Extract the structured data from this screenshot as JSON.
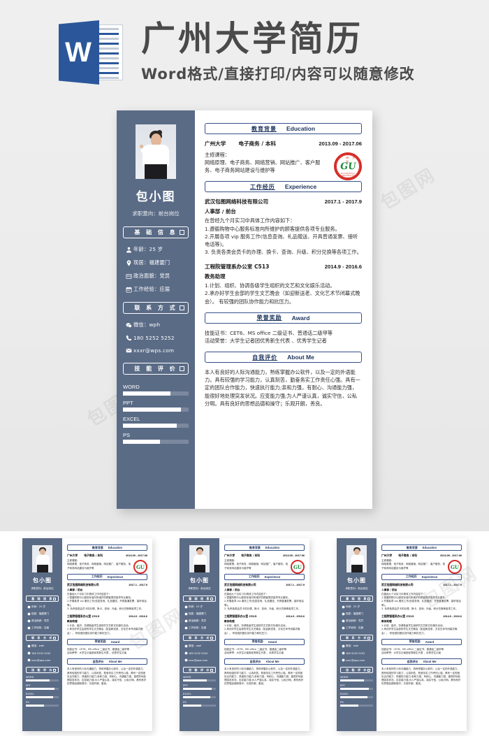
{
  "banner": {
    "title": "广州大学简历",
    "subtitle": "Word格式/直接打印/内容可以随意修改",
    "word_icon_letter": "W",
    "icon_name": "word-document-icon"
  },
  "colors": {
    "sidebar": "#5a6b86",
    "accent_blue": "#35508a",
    "heading_blue": "#20365f",
    "word_blue": "#2b579a",
    "seal_red": "#d62b26",
    "seal_green": "#1f8a3b",
    "page_bg": "#ececec"
  },
  "resume": {
    "sidebar": {
      "photo_alt": "candidate-portrait",
      "name": "包小图",
      "job_intention": "求职意向：前台岗位",
      "sections": [
        {
          "cn": "基 础 信 息",
          "key": "basic-info"
        },
        {
          "cn": "联 系 方 式",
          "key": "contact"
        },
        {
          "cn": "技 能 评 价",
          "key": "skills"
        }
      ],
      "basic_info": [
        {
          "icon": "user-icon",
          "text": "年龄：25 岁"
        },
        {
          "icon": "location-pin-icon",
          "text": "现居：福建厦门"
        },
        {
          "icon": "id-card-icon",
          "text": "政治面貌：党员"
        },
        {
          "icon": "calendar-icon",
          "text": "工作经验：应届"
        }
      ],
      "contact": [
        {
          "icon": "wechat-icon",
          "text": "微信：wph"
        },
        {
          "icon": "phone-icon",
          "text": "180 5252 5252"
        },
        {
          "icon": "email-icon",
          "text": "xxxr@wps.com"
        }
      ],
      "skills": [
        {
          "label": "WORD",
          "percent": 72
        },
        {
          "label": "PPT",
          "percent": 88
        },
        {
          "label": "EXCEL",
          "percent": 82
        },
        {
          "label": "PS",
          "percent": 56
        }
      ]
    },
    "main": {
      "education": {
        "cn": "教育背景",
        "en": "Education",
        "school": "广州大学",
        "major": "电子商务 / 本科",
        "dates": "2013.09 - 2017.06",
        "courses_label": "主修课程：",
        "courses": "网络原理、电子商务、网络营销、网站推广、客户服务、电子商务网站建设与维护等",
        "seal": {
          "top": "广 州 大 学",
          "emblem": "GU",
          "bottom": "GUANGZHOU UNIVERSITY"
        }
      },
      "experience": {
        "cn": "工作经历",
        "en": "Experience",
        "jobs": [
          {
            "company": "武汉包图网络科技有限公司",
            "dates": "2017.1 - 2017.9",
            "role": "人事部 / 前台",
            "intro": "在曾经九个月实习中具体工作内容如下：",
            "duties": [
              "1.遵循购物中心服务标准向所维护的顾客提供各项专业服务。",
              "2.开展各项 vip 服务工作(信息查询、礼品赠送、开具普通发票、接听电话等)。",
              "3. 负责各类会员卡的办理、换卡、查询、升级、积分兑换等各项工作。"
            ]
          },
          {
            "company": "工程院管理系办公室 C513",
            "dates": "2014.9 - 2016.6",
            "role": "教务助理",
            "intro": "",
            "duties": [
              "1.计划、组织、协调各级学生组织的文艺和文化娱乐活动。",
              "2.承办好学生会部的学生文艺晚会（如迎新送老、文化艺术节闭幕式晚会）。  有较强的团队协作能力和抗压力。"
            ]
          }
        ]
      },
      "award": {
        "cn": "荣誉奖励",
        "en": "Award",
        "lines": [
          "技能证书：CET6、MS office 二级证书、普通话二级甲等",
          "活动荣誉：大学生记者团优秀新生代表 、优秀学生记者"
        ]
      },
      "about": {
        "cn": "自我评价",
        "en": "About Me",
        "text": "本人有良好的人际沟通能力，熟练掌握办公软件，以及一定的外语能力。具有较强的学习能力，认真刻苦，勤奋务实工作责任心强。具有一定的团队合作能力，快速执行能力;亲和力强，有耐心、沟通能力强，能很好地处理突发状况。应变能力强;为人严谨认真，诚实守信，公私分明。具有良好的思想品德和操守；乐观开朗，善良。"
      }
    }
  },
  "thumbnails": {
    "count": 3,
    "items": [
      {
        "label": "resume-preview-1"
      },
      {
        "label": "resume-preview-2"
      },
      {
        "label": "resume-preview-3"
      }
    ]
  },
  "watermark": "包图网"
}
